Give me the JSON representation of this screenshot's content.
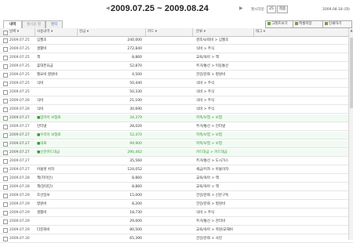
{
  "period": {
    "text": "2009.07.25 ~ 2009.08.24",
    "prev": "◀",
    "next": "▶"
  },
  "settings": {
    "label": "월시작일:",
    "value": "25",
    "apply": "적용"
  },
  "today": "2009.08.18 (화)",
  "tabs": [
    "내역",
    "월사용 별",
    "월력"
  ],
  "toolbar": {
    "graph": "그래프보기",
    "excel": "엑셀저장",
    "print": "인쇄하기"
  },
  "columns": {
    "date": "날짜 ▾",
    "item": "사용내역 ▾",
    "cash": "현금 ▾",
    "card": "카드 ▾",
    "category": "분류 ▾",
    "tag": "태그 ▾"
  },
  "rows": [
    {
      "date": "2009.07.25",
      "item": "심월초",
      "cash": "240,000",
      "card": "",
      "category": "경조사/회비 > 심월초",
      "tag": "",
      "hl": false
    },
    {
      "date": "2009.07.25",
      "item": "생활비",
      "cash": "272,840",
      "card": "",
      "category": "식비 > 주식",
      "tag": "",
      "hl": false
    },
    {
      "date": "2009.07.25",
      "item": "책",
      "cash": "8,860",
      "card": "",
      "category": "교육/육아 > 책",
      "tag": "",
      "hl": false
    },
    {
      "date": "2009.07.25",
      "item": "휴대폰요금",
      "cash": "52,870",
      "card": "",
      "category": "주거/통신 > 이동통신",
      "tag": "",
      "hl": false
    },
    {
      "date": "2009.07.25",
      "item": "월요비 병원비",
      "cash": "4,500",
      "card": "",
      "category": "건강/문화 > 병원비",
      "tag": "",
      "hl": false
    },
    {
      "date": "2009.07.25",
      "item": "식비",
      "cash": "50,440",
      "card": "",
      "category": "식비 > 주식",
      "tag": "",
      "hl": false
    },
    {
      "date": "2009.07.25",
      "item": "",
      "cash": "50,330",
      "card": "",
      "category": "식비 > 주식",
      "tag": "",
      "hl": false
    },
    {
      "date": "2009.07.26",
      "item": "식비",
      "cash": "21,100",
      "card": "",
      "category": "식비 > 주식",
      "tag": "",
      "hl": false
    },
    {
      "date": "2009.07.26",
      "item": "식비",
      "cash": "30,690",
      "card": "",
      "category": "식비 > 주식",
      "tag": "",
      "hl": false
    },
    {
      "date": "2009.07.27",
      "item": "■엄마이 보험료",
      "cash": "34,379",
      "card": "",
      "category": "저축/보험 > 보험",
      "tag": "",
      "hl": true
    },
    {
      "date": "2009.07.27",
      "item": "인터넷",
      "cash": "28,020",
      "card": "",
      "category": "주거/통신 > 인터넷",
      "tag": "",
      "hl": false
    },
    {
      "date": "2009.07.27",
      "item": "■우리이 보험료",
      "cash": "52,470",
      "card": "",
      "category": "저축/보험 > 보험",
      "tag": "",
      "hl": true
    },
    {
      "date": "2009.07.27",
      "item": "■의료",
      "cash": "99,900",
      "card": "",
      "category": "저축/보험 > 보험",
      "tag": "",
      "hl": true
    },
    {
      "date": "2009.07.27",
      "item": "■신한카드대금",
      "cash": "290,462",
      "card": "",
      "category": "카드대금 > 카드대금",
      "tag": "",
      "hl": true
    },
    {
      "date": "2009.07.27",
      "item": "",
      "cash": "35,560",
      "card": "",
      "category": "주거/통신 > 도시가스",
      "tag": "",
      "hl": false
    },
    {
      "date": "2009.07.27",
      "item": "아울렛 쉬자",
      "cash": "124,052",
      "card": "",
      "category": "세금/이자 > 아울이자",
      "tag": "",
      "hl": false
    },
    {
      "date": "2009.07.28",
      "item": "책(지미인)",
      "cash": "8,860",
      "card": "",
      "category": "교육/육아 > 책",
      "tag": "",
      "hl": false
    },
    {
      "date": "2009.07.28",
      "item": "책(달의단)",
      "cash": "8,860",
      "card": "",
      "category": "교육/육아 > 책",
      "tag": "",
      "hl": false
    },
    {
      "date": "2009.07.29",
      "item": "조선일보",
      "cash": "15,000",
      "card": "",
      "category": "건강/문화 > 신문구독",
      "tag": "",
      "hl": false
    },
    {
      "date": "2009.07.29",
      "item": "병원비",
      "cash": "8,200",
      "card": "",
      "category": "건강/문화 > 병원비",
      "tag": "",
      "hl": false
    },
    {
      "date": "2009.07.29",
      "item": "생활비",
      "cash": "18,730",
      "card": "",
      "category": "식비 > 주식",
      "tag": "",
      "hl": false
    },
    {
      "date": "2009.07.29",
      "item": "",
      "cash": "29,000",
      "card": "",
      "category": "주거/통신 > 관리비",
      "tag": "",
      "hl": false
    },
    {
      "date": "2009.07.29",
      "item": "다문화비",
      "cash": "80,500",
      "card": "",
      "category": "교육/육아 > 학원/교재비",
      "tag": "",
      "hl": false
    },
    {
      "date": "2009.07.30",
      "item": "",
      "cash": "65,390",
      "card": "",
      "category": "건강/문화 > 사진",
      "tag": "",
      "hl": false
    }
  ]
}
